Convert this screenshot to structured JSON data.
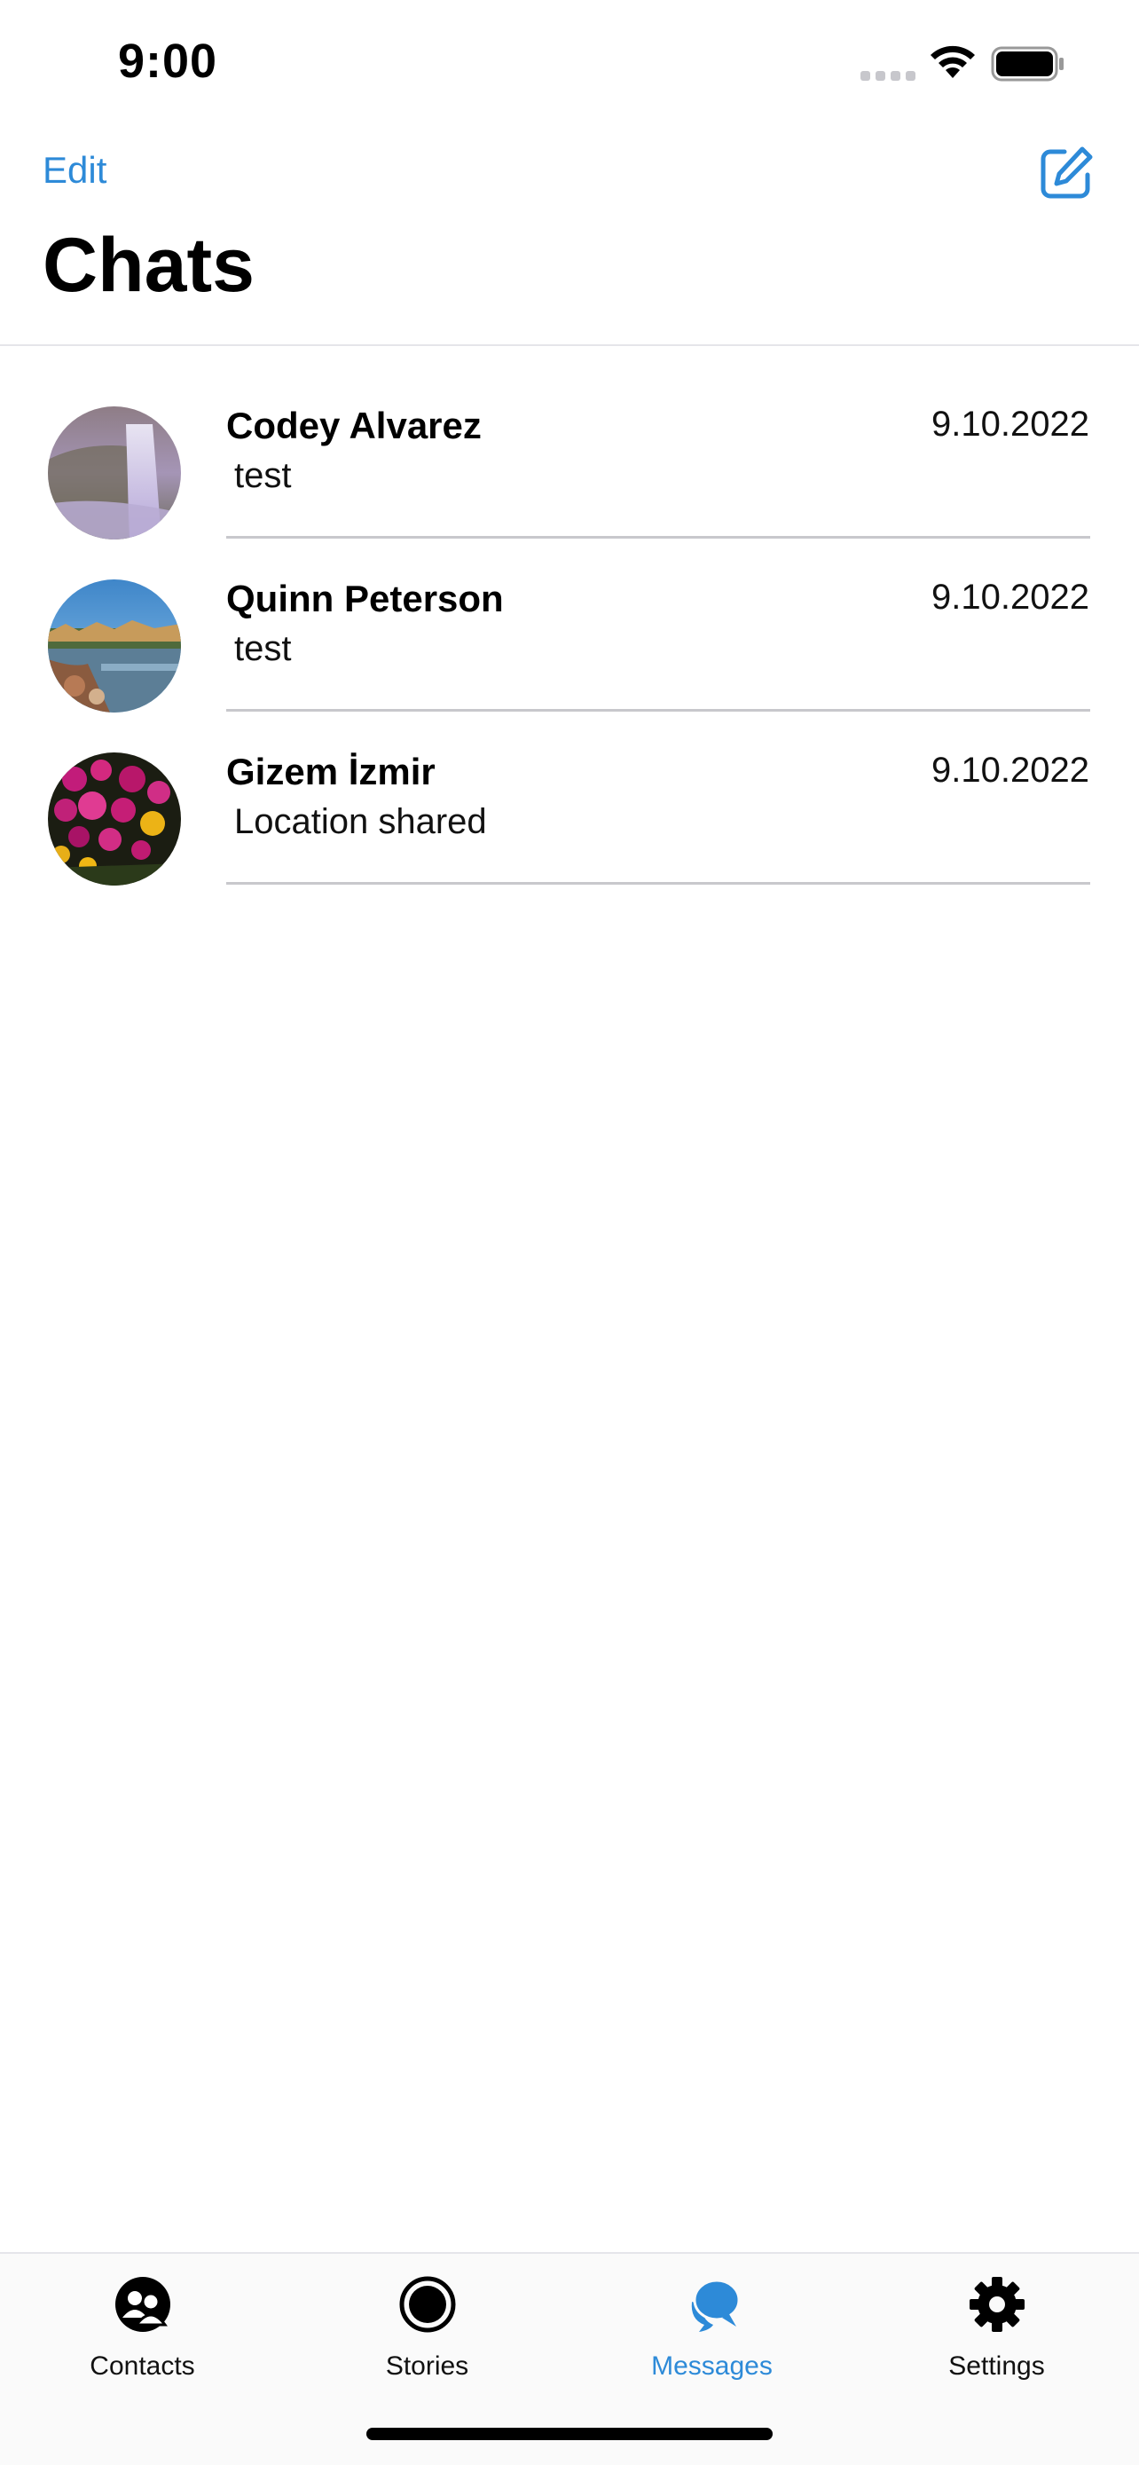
{
  "status_bar": {
    "time": "9:00"
  },
  "header": {
    "edit_label": "Edit",
    "title": "Chats",
    "compose_icon": "compose-icon"
  },
  "chats": [
    {
      "name": "Codey Alvarez",
      "date": "9.10.2022",
      "preview": "test",
      "avatar": "waterfall-photo"
    },
    {
      "name": "Quinn Peterson",
      "date": "9.10.2022",
      "preview": "test",
      "avatar": "lake-photo"
    },
    {
      "name": "Gizem İzmir",
      "date": "9.10.2022",
      "preview": "Location shared",
      "avatar": "flowers-photo"
    }
  ],
  "tabs": [
    {
      "label": "Contacts",
      "icon": "contacts-icon",
      "active": false
    },
    {
      "label": "Stories",
      "icon": "stories-icon",
      "active": false
    },
    {
      "label": "Messages",
      "icon": "messages-icon",
      "active": true
    },
    {
      "label": "Settings",
      "icon": "settings-icon",
      "active": false
    }
  ],
  "colors": {
    "accent": "#2d8ad8",
    "divider": "#c8c8cc"
  }
}
